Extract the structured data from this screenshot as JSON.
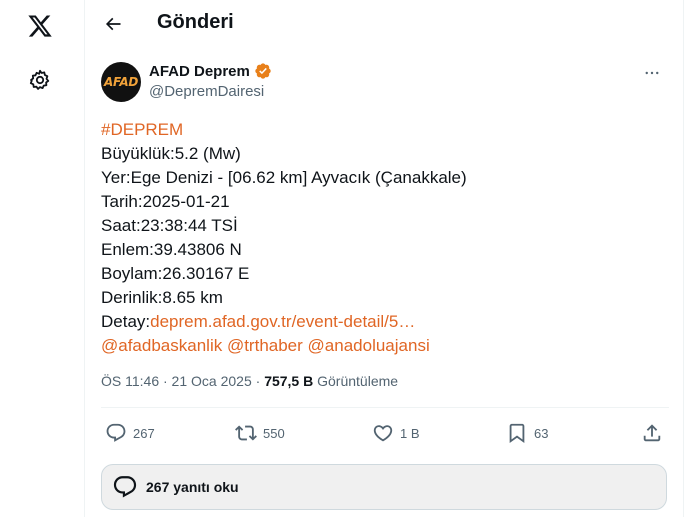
{
  "header": {
    "title": "Gönderi"
  },
  "tweet": {
    "author_name": "AFAD Deprem",
    "handle": "@DepremDairesi",
    "avatar_text": "AFAD",
    "hashtag": "#DEPREM",
    "lines": {
      "magnitude": "Büyüklük:5.2 (Mw)",
      "location": "Yer:Ege Denizi - [06.62 km] Ayvacık (Çanakkale)",
      "date": "Tarih:2025-01-21",
      "time": "Saat:23:38:44 TSİ",
      "latitude": "Enlem:39.43806 N",
      "longitude": "Boylam:26.30167 E",
      "depth": "Derinlik:8.65 km",
      "detail_label": "Detay:",
      "detail_link": "deprem.afad.gov.tr/event-detail/5…"
    },
    "mentions": [
      "@afadbaskanlik",
      "@trthaber",
      "@anadoluajansi"
    ],
    "timestamp": "ÖS 11:46 · 21 Oca 2025",
    "separator": " · ",
    "views_count": "757,5 B",
    "views_label": "Görüntüleme"
  },
  "actions": {
    "replies": "267",
    "reposts": "550",
    "likes": "1 B",
    "bookmarks": "63"
  },
  "replies_bar": {
    "label": "267 yanıtı oku"
  },
  "colors": {
    "accent": "#e06625",
    "verified": "#e8801a",
    "text": "#0f1419",
    "muted": "#536471"
  }
}
